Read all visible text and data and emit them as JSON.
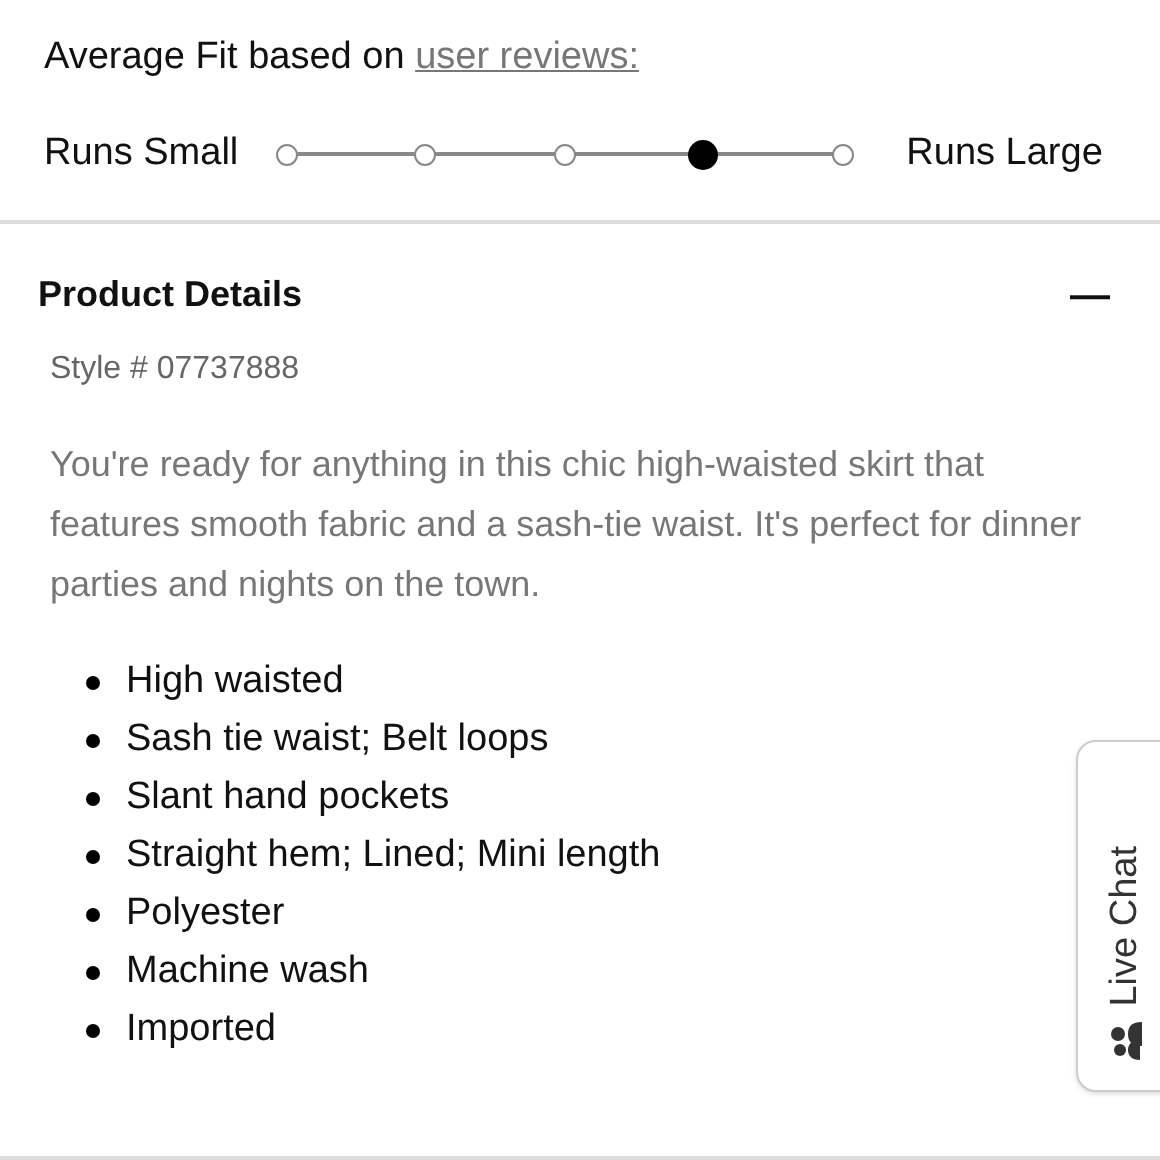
{
  "fit": {
    "label": "Average Fit based on",
    "link": "user reviews:",
    "min_label": "Runs Small",
    "max_label": "Runs Large",
    "points": [
      {
        "selected": false
      },
      {
        "selected": false
      },
      {
        "selected": false
      },
      {
        "selected": true
      },
      {
        "selected": false
      }
    ]
  },
  "details": {
    "title": "Product Details",
    "expanded": true,
    "toggle": "—",
    "style": "Style # 07737888",
    "description": "You're ready for anything in this chic high-waisted skirt that features smooth fabric and a sash-tie waist. It's perfect for dinner parties and nights on the town.",
    "bullets": [
      "High waisted",
      "Sash tie waist; Belt loops",
      "Slant hand pockets",
      "Straight hem; Lined; Mini length",
      "Polyester",
      "Machine wash",
      "Imported"
    ]
  },
  "live_chat": {
    "label": "Live Chat"
  }
}
